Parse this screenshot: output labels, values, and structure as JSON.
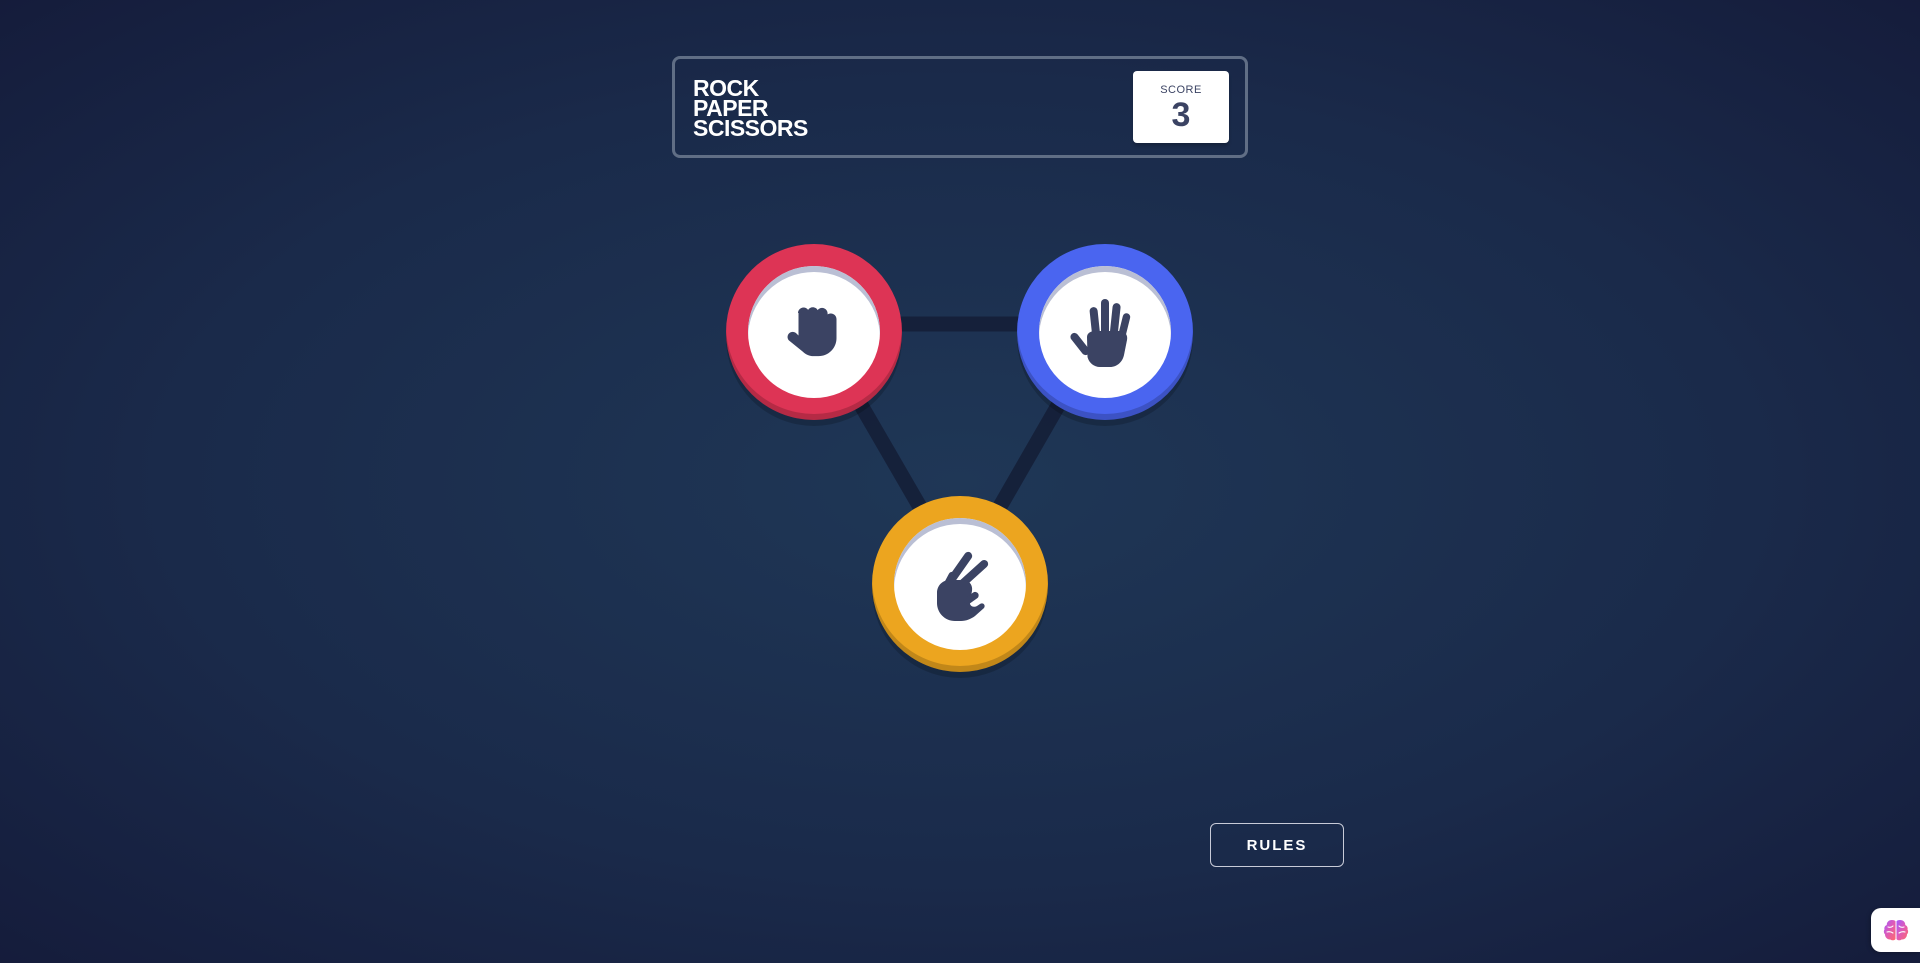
{
  "header": {
    "title_lines": [
      "ROCK",
      "PAPER",
      "SCISSORS"
    ],
    "score": {
      "label": "SCORE",
      "value": "3"
    }
  },
  "board": {
    "tokens": [
      {
        "id": "rock",
        "icon": "fist-icon",
        "color": "#dd3455"
      },
      {
        "id": "paper",
        "icon": "open-hand-icon",
        "color": "#4a65f0"
      },
      {
        "id": "scissors",
        "icon": "peace-hand-icon",
        "color": "#eca51f"
      }
    ]
  },
  "rules_button": {
    "label": "RULES"
  },
  "corner_widget": {
    "icon": "brain-icon"
  },
  "colors": {
    "background": "#1f3756",
    "header_border": "#606e85",
    "score_text": "#3b4363",
    "rock": "#dd3455",
    "paper": "#4a65f0",
    "scissors": "#eca51f"
  }
}
